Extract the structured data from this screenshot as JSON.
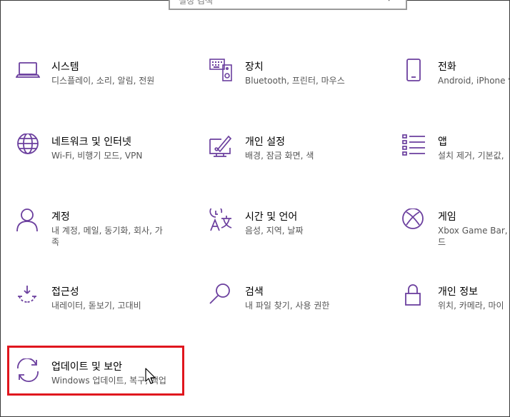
{
  "search": {
    "placeholder": "설정 검색"
  },
  "accent": "#6b3f9e",
  "highlight_color": "#e0161e",
  "tiles": [
    {
      "title": "시스템",
      "desc": "디스플레이, 소리, 알림, 전원",
      "icon": "laptop-icon"
    },
    {
      "title": "장치",
      "desc": "Bluetooth, 프린터, 마우스",
      "icon": "keyboard-device-icon"
    },
    {
      "title": "전화",
      "desc": "Android, iPhone 연",
      "icon": "phone-icon"
    },
    {
      "title": "네트워크 및 인터넷",
      "desc": "Wi-Fi, 비행기 모드, VPN",
      "icon": "globe-icon"
    },
    {
      "title": "개인 설정",
      "desc": "배경, 잠금 화면, 색",
      "icon": "personalization-icon"
    },
    {
      "title": "앱",
      "desc": "설치 제거, 기본값,",
      "icon": "apps-list-icon"
    },
    {
      "title": "계정",
      "desc": "내 계정, 메일, 동기화, 회사, 가\n족",
      "icon": "person-icon"
    },
    {
      "title": "시간 및 언어",
      "desc": "음성, 지역, 날짜",
      "icon": "time-language-icon"
    },
    {
      "title": "게임",
      "desc": "Xbox Game Bar, 캡\n드",
      "icon": "xbox-icon"
    },
    {
      "title": "접근성",
      "desc": "내레이터, 돋보기, 고대비",
      "icon": "ease-of-access-icon"
    },
    {
      "title": "검색",
      "desc": "내 파일 찾기, 사용 권한",
      "icon": "search-icon"
    },
    {
      "title": "개인 정보",
      "desc": "위치, 카메라, 마이",
      "icon": "lock-icon"
    },
    {
      "title": "업데이트 및 보안",
      "desc": "Windows 업데이트, 복구, 백업",
      "icon": "sync-icon"
    }
  ]
}
